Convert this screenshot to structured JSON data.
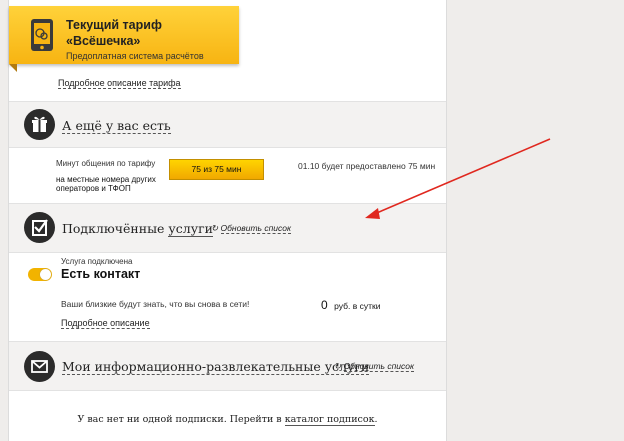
{
  "tariff": {
    "title_line1": "Текущий тариф",
    "title_line2": "«Всёшечка»",
    "subtitle": "Предоплатная система расчётов",
    "details_link": "Подробное описание тарифа"
  },
  "extras": {
    "title": "А ещё у вас есть",
    "minutes_label": "Минут общения по тарифу",
    "minutes_scope_line1": "на местные номера других",
    "minutes_scope_line2": "операторов и ТФОП",
    "minutes_value": "75 из 75 мин",
    "minutes_note": "01.10 будет предоставлено 75 мин",
    "progress_fraction": 1.0
  },
  "connected": {
    "title_plain": "Подключённые",
    "title_link": "услуги",
    "refresh": "Обновить список",
    "service_status": "Услуга подключена",
    "service_name": "Есть контакт",
    "service_desc": "Ваши близкие будут знать, что вы снова в сети!",
    "price_value": "0",
    "price_unit": "руб. в сутки",
    "details_link": "Подробное описание"
  },
  "info_services": {
    "title": "Мои информационно-развлекательные услуги",
    "refresh": "Обновить список",
    "empty_text": "У вас нет ни одной подписки. Перейти в",
    "catalog_link": "каталог подписок",
    "period": "."
  },
  "colors": {
    "accent": "#f7b412",
    "arrow": "#e0281f"
  }
}
